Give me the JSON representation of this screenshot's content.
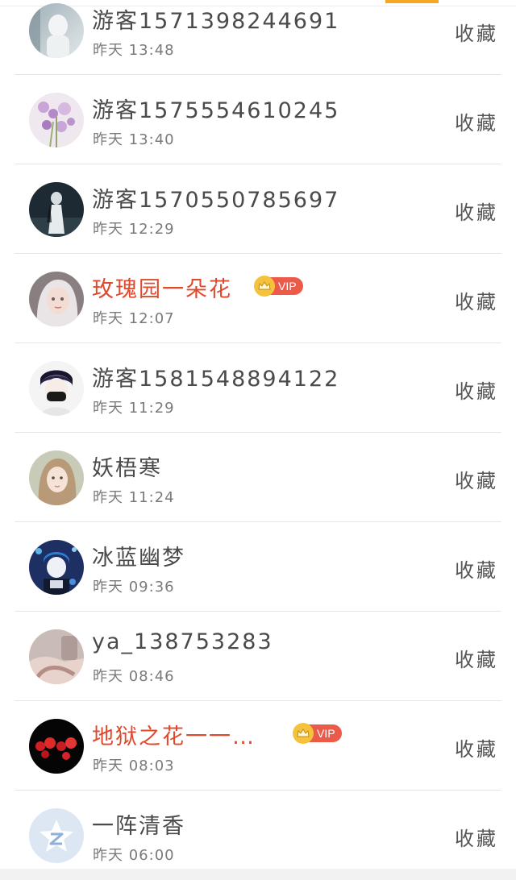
{
  "header": {
    "accent_color": "#f5a623"
  },
  "colors": {
    "vip_name": "#e0492c",
    "vip_badge": "#ec5a4a",
    "crown": "#f5c33b"
  },
  "favorite_label": "收藏",
  "vip_label": "VIP",
  "items": [
    {
      "name": "游客1571398244691",
      "time": "昨天 13:48",
      "vip": false,
      "avatar": "avatar-photo-icon"
    },
    {
      "name": "游客1575554610245",
      "time": "昨天 13:40",
      "vip": false,
      "avatar": "avatar-lavender-icon"
    },
    {
      "name": "游客1570550785697",
      "time": "昨天 12:29",
      "vip": false,
      "avatar": "avatar-dark-figure-icon"
    },
    {
      "name": "玫瑰园一朵花",
      "time": "昨天 12:07",
      "vip": true,
      "avatar": "avatar-anime-girl-icon"
    },
    {
      "name": "游客1581548894122",
      "time": "昨天 11:29",
      "vip": false,
      "avatar": "avatar-masked-boy-icon"
    },
    {
      "name": "妖梧寒",
      "time": "昨天 11:24",
      "vip": false,
      "avatar": "avatar-girl-portrait-icon"
    },
    {
      "name": "冰蓝幽梦",
      "time": "昨天 09:36",
      "vip": false,
      "avatar": "avatar-blue-anime-icon"
    },
    {
      "name": "ya_138753283",
      "time": "昨天 08:46",
      "vip": false,
      "avatar": "avatar-hands-icon"
    },
    {
      "name": "地狱之花一一…",
      "time": "昨天 08:03",
      "vip": true,
      "avatar": "avatar-red-flowers-icon"
    },
    {
      "name": "一阵清香",
      "time": "昨天 06:00",
      "vip": false,
      "avatar": "avatar-default-star-icon"
    }
  ]
}
